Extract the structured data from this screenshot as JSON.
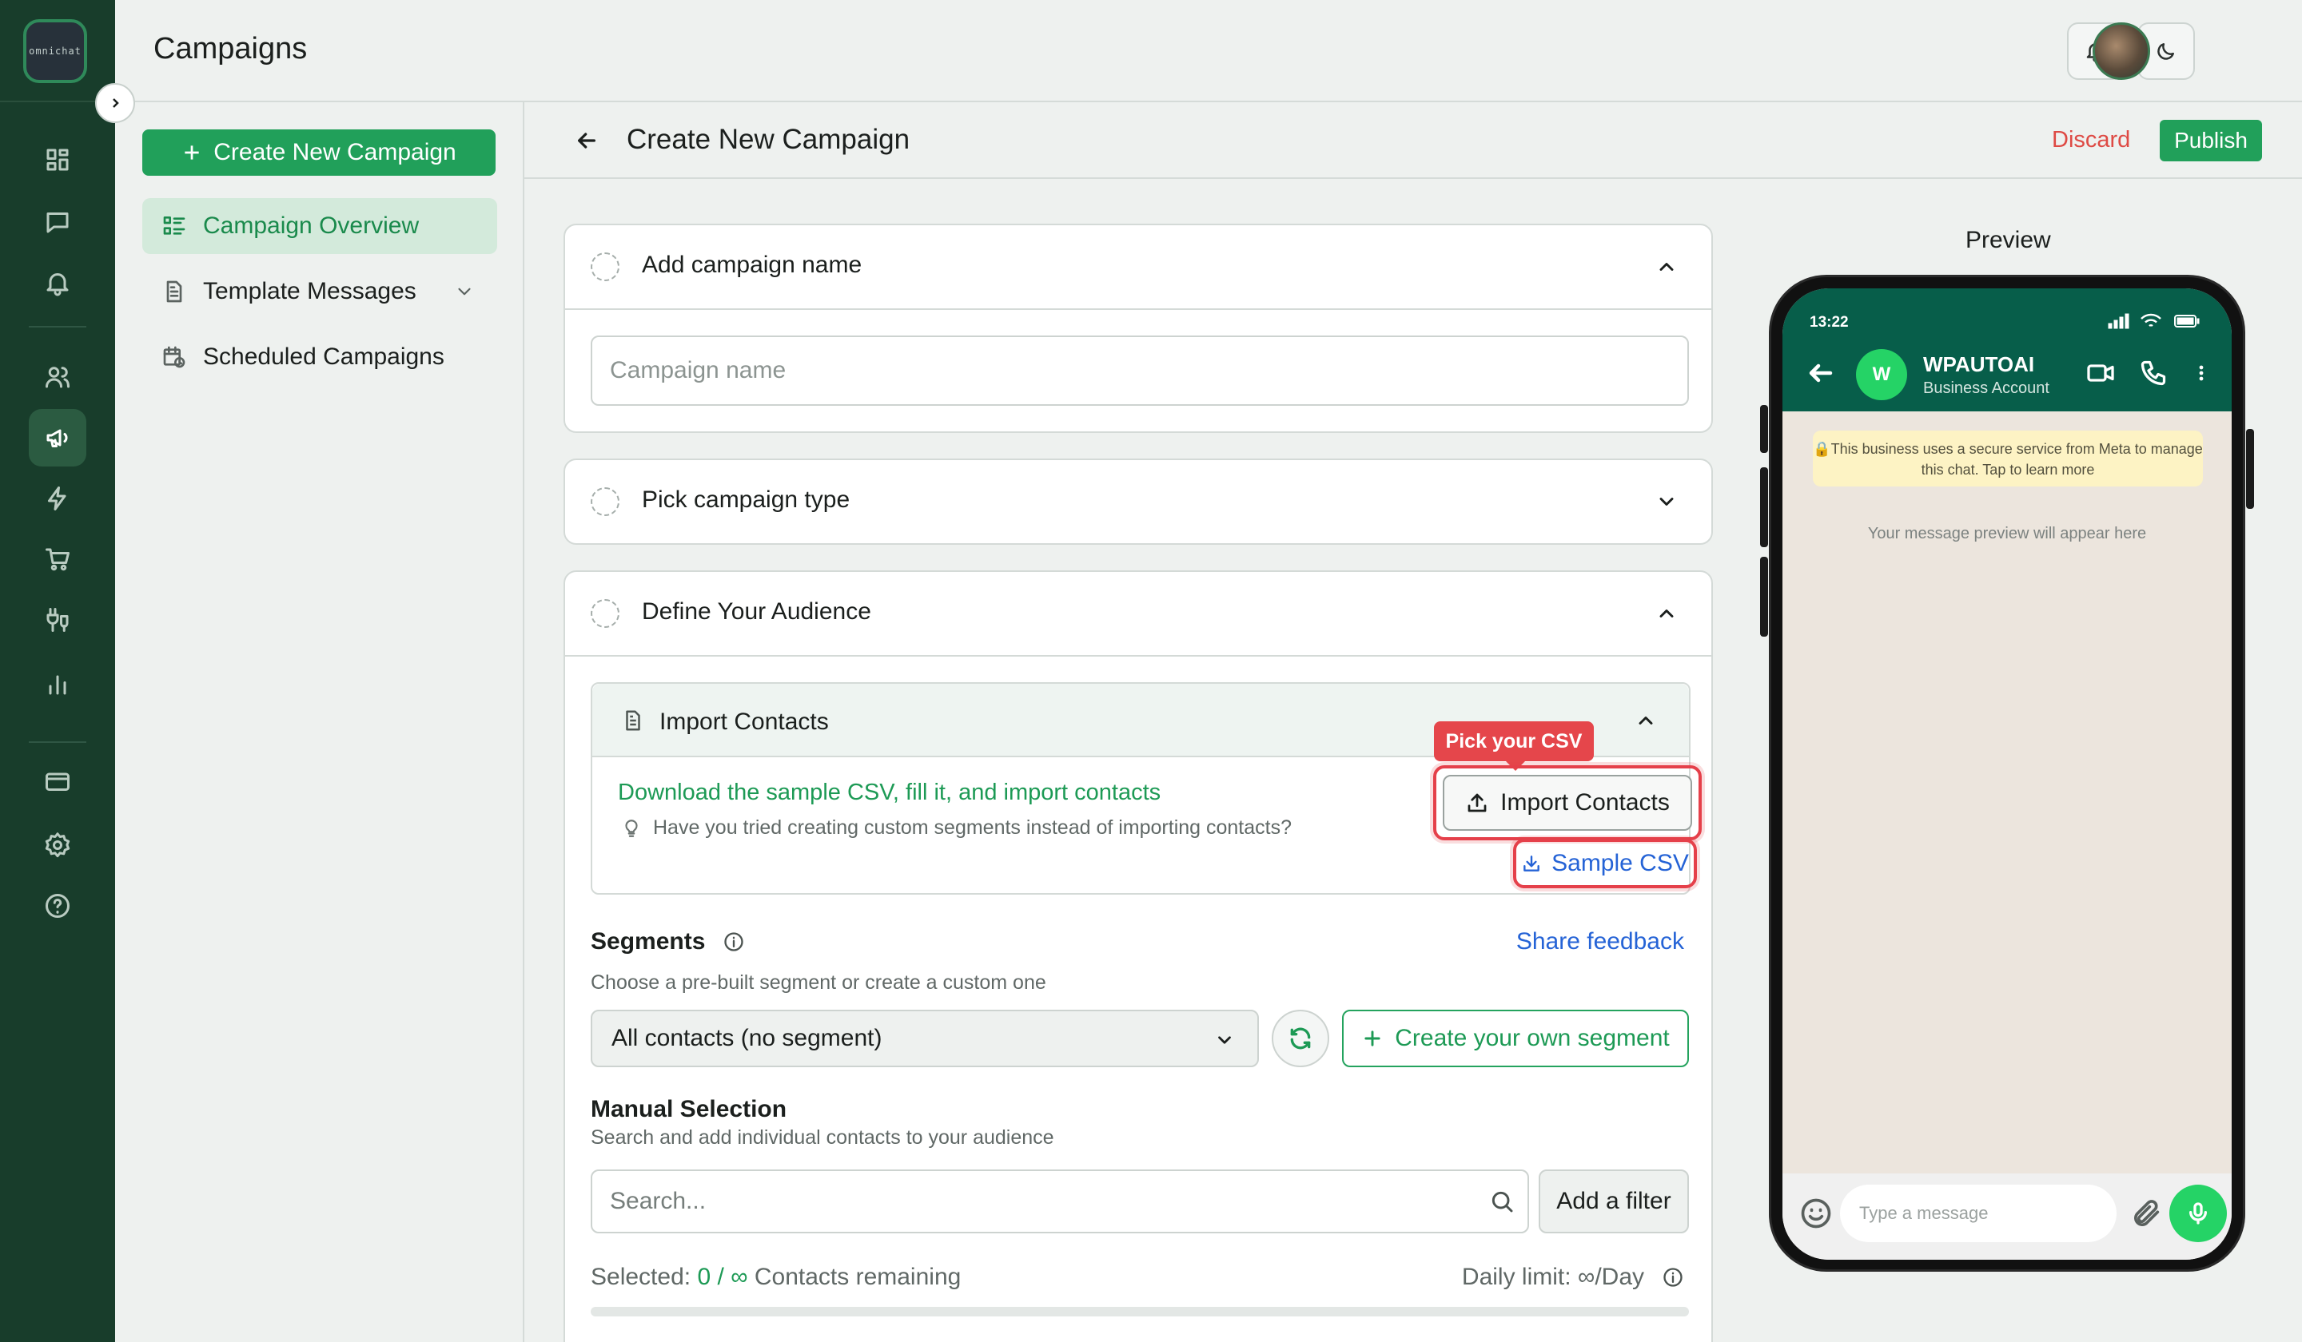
{
  "app": {
    "logo_text": "omnichat",
    "page_title": "Campaigns"
  },
  "rail": {
    "items": [
      {
        "name": "dashboard",
        "icon": "grid-icon"
      },
      {
        "name": "inbox",
        "icon": "chat-icon"
      },
      {
        "name": "notifications",
        "icon": "bell-icon"
      },
      {
        "name": "contacts",
        "icon": "users-icon"
      },
      {
        "name": "campaigns",
        "icon": "megaphone-icon",
        "active": true
      },
      {
        "name": "automation",
        "icon": "bolt-icon"
      },
      {
        "name": "commerce",
        "icon": "cart-icon"
      },
      {
        "name": "integrations",
        "icon": "plug-icon"
      },
      {
        "name": "analytics",
        "icon": "bar-chart-icon"
      },
      {
        "name": "billing",
        "icon": "card-icon"
      },
      {
        "name": "settings",
        "icon": "gear-icon"
      },
      {
        "name": "help",
        "icon": "help-icon"
      }
    ]
  },
  "sidebar": {
    "create_label": "Create New Campaign",
    "items": [
      {
        "label": "Campaign Overview",
        "active": true
      },
      {
        "label": "Template Messages",
        "expandable": true
      },
      {
        "label": "Scheduled Campaigns"
      }
    ]
  },
  "main": {
    "title": "Create New Campaign",
    "discard_label": "Discard",
    "publish_label": "Publish"
  },
  "steps": {
    "name": {
      "title": "Add campaign name",
      "input_placeholder": "Campaign name",
      "input_value": ""
    },
    "type": {
      "title": "Pick campaign type"
    },
    "audience": {
      "title": "Define Your Audience",
      "import": {
        "title": "Import Contacts",
        "download_link": "Download the sample CSV, fill it, and import contacts",
        "hint": "Have you tried creating custom segments instead of importing contacts?",
        "badge": "Pick your CSV",
        "import_button": "Import Contacts",
        "sample_button": "Sample CSV"
      },
      "segments": {
        "title": "Segments",
        "share_feedback": "Share feedback",
        "subtitle": "Choose a pre-built segment or create a custom one",
        "selected": "All contacts (no segment)",
        "create_own": "Create your own segment"
      },
      "manual": {
        "title": "Manual Selection",
        "subtitle": "Search and add individual contacts to your audience",
        "search_placeholder": "Search...",
        "filter_label": "Add a filter",
        "selected_prefix": "Selected:",
        "selected_value": "0 / ∞",
        "selected_suffix": "Contacts remaining",
        "daily_limit": "Daily limit: ∞/Day",
        "progress": 0
      }
    }
  },
  "preview": {
    "label": "Preview",
    "status_time": "13:22",
    "avatar_letter": "W",
    "contact_name": "WPAUTOAI",
    "contact_sub": "Business Account",
    "notice": "🔒This business uses a secure service from Meta to manage this chat. Tap to learn more",
    "empty_text": "Your message preview will appear here",
    "input_placeholder": "Type a message"
  },
  "colors": {
    "brand_green": "#21a05a",
    "rail_bg": "#183d2b",
    "highlight_red": "#e5404a",
    "link_blue": "#2563d6",
    "whatsapp_header": "#075e4a"
  }
}
